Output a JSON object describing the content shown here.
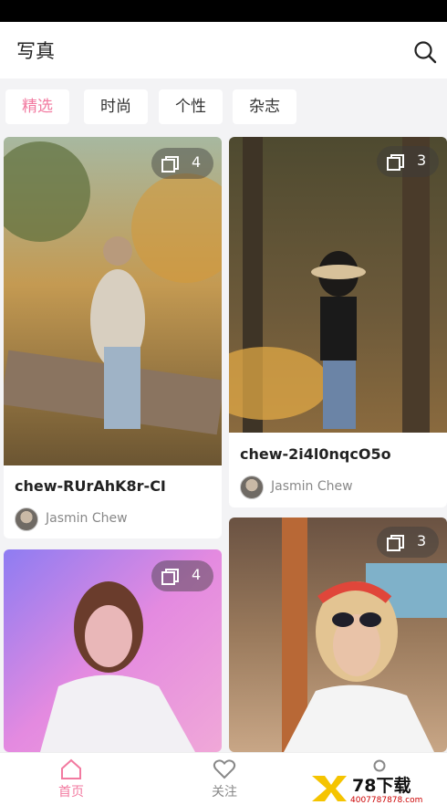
{
  "header": {
    "title": "写真"
  },
  "tabs": [
    {
      "label": "精选",
      "active": true
    },
    {
      "label": "时尚",
      "active": false
    },
    {
      "label": "个性",
      "active": false
    },
    {
      "label": "杂志",
      "active": false
    }
  ],
  "cards": [
    {
      "title": "chew-RUrAhK8r-CI",
      "author": "Jasmin Chew",
      "count": "4"
    },
    {
      "title": "chew-2i4l0nqcO5o",
      "author": "Jasmin Chew",
      "count": "3"
    },
    {
      "title": "",
      "author": "",
      "count": "4"
    },
    {
      "title": "",
      "author": "",
      "count": "3"
    }
  ],
  "bottom_nav": [
    {
      "label": "首页",
      "active": true
    },
    {
      "label": "关注",
      "active": false
    }
  ],
  "watermark": {
    "brand": "78下载",
    "url": "4007787878.com"
  },
  "colors": {
    "accent": "#f27aa0"
  }
}
